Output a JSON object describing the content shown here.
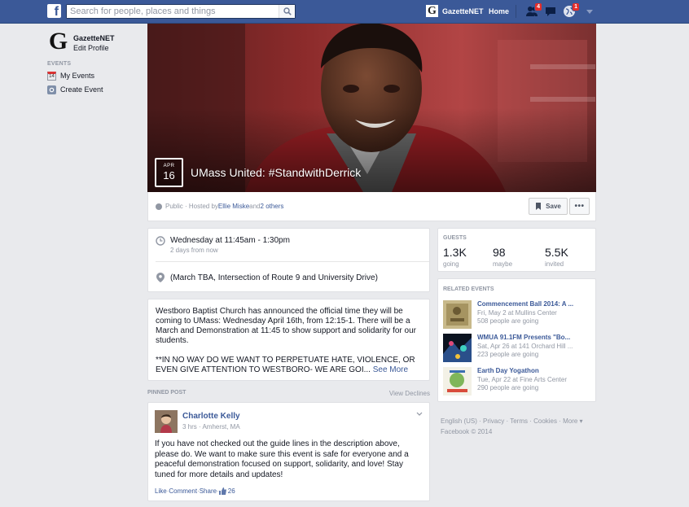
{
  "topbar": {
    "logo": "f",
    "search_placeholder": "Search for people, places and things",
    "profile_initial": "G",
    "profile_name": "GazetteNET",
    "home": "Home",
    "friend_badge": "4",
    "globe_badge": "1"
  },
  "leftnav": {
    "avatar_initial": "G",
    "name": "GazetteNET",
    "edit": "Edit Profile",
    "heading": "EVENTS",
    "items": [
      {
        "label": "My Events",
        "icon_text": "14"
      },
      {
        "label": "Create Event"
      }
    ]
  },
  "event": {
    "month": "APR",
    "day": "16",
    "title": "UMass United: #StandwithDerrick"
  },
  "meta": {
    "prefix": "Public · Hosted by ",
    "host": "Ellie Miske",
    "and": " and ",
    "others": "2 others",
    "save": "Save",
    "more": "•••"
  },
  "when": {
    "time": "Wednesday at 11:45am - 1:30pm",
    "relative": "2 days from now",
    "location": "(March TBA, Intersection of Route 9 and University Drive)"
  },
  "description": {
    "p1": "Westboro Baptist Church has announced the official time they will be coming to UMass: Wednesday April 16th, from 12:15-1. There will be a March and Demonstration at 11:45 to show support and solidarity for our students.",
    "p2": "**IN NO WAY DO WE WANT TO PERPETUATE HATE, VIOLENCE, OR EVEN GIVE ATTENTION TO WESTBORO- WE ARE GOI...",
    "see_more": "See More"
  },
  "pinned": {
    "heading": "PINNED POST",
    "view_declines": "View Declines",
    "author": "Charlotte Kelly",
    "meta": "3 hrs · Amherst, MA",
    "body": "If you have not checked out the guide lines in the description above, please do. We want to make sure this event is safe for everyone and a peaceful demonstration focused on support, solidarity, and love! Stay tuned for more details and updates!",
    "like": "Like",
    "comment": "Comment",
    "share": "Share",
    "sep": " · ",
    "likes": "26"
  },
  "guests": {
    "heading": "GUESTS",
    "going_count": "1.3K",
    "going_label": "going",
    "maybe_count": "98",
    "maybe_label": "maybe",
    "invited_count": "5.5K",
    "invited_label": "invited"
  },
  "related": {
    "heading": "RELATED EVENTS",
    "items": [
      {
        "title": "Commencement Ball 2014: A ...",
        "when": "Fri, May 2 at Mullins Center",
        "going": "508 people are going"
      },
      {
        "title": "WMUA 91.1FM Presents \"Bo...",
        "when": "Sat, Apr 26 at 141 Orchard Hill ...",
        "going": "223 people are going"
      },
      {
        "title": "Earth Day Yogathon",
        "when": "Tue, Apr 22 at Fine Arts Center",
        "going": "290 people are going"
      }
    ]
  },
  "footer": {
    "line1": "English (US) · Privacy · Terms · Cookies · More ▾",
    "line2": "Facebook © 2014"
  },
  "colors": {
    "brand": "#3b5998",
    "badge": "#e42e2b",
    "background": "#e9eaed"
  },
  "icons": [
    "facebook-logo",
    "search-icon",
    "friends-icon",
    "messages-icon",
    "globe-icon",
    "calendar-icon",
    "create-event-icon",
    "clock-icon",
    "map-pin-icon",
    "bookmark-icon",
    "thumbs-up-icon",
    "chevron-down-icon"
  ]
}
